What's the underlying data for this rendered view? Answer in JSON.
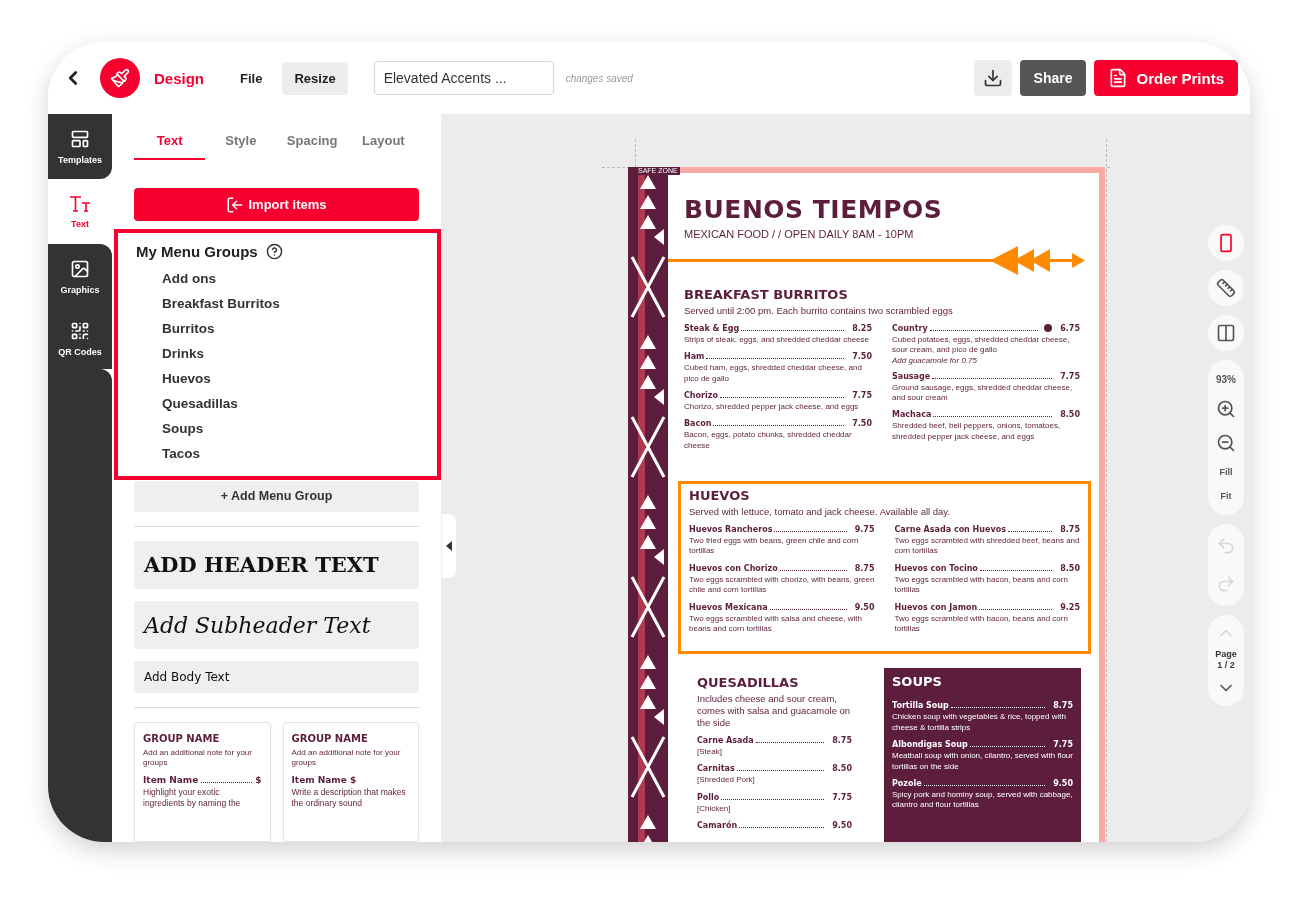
{
  "top_bar": {
    "app_name": "Design",
    "menu": [
      "File",
      "Resize"
    ],
    "document_title": "Elevated Accents ...",
    "save_status": "changes saved",
    "share": "Share",
    "order": "Order Prints"
  },
  "rail": [
    {
      "label": "Templates",
      "selected": false
    },
    {
      "label": "Text",
      "selected": true
    },
    {
      "label": "Graphics",
      "selected": false
    },
    {
      "label": "QR Codes",
      "selected": false
    }
  ],
  "panel": {
    "tabs": [
      {
        "label": "Text",
        "selected": true
      },
      {
        "label": "Style",
        "selected": false
      },
      {
        "label": "Spacing",
        "selected": false
      },
      {
        "label": "Layout",
        "selected": false
      }
    ],
    "import_button": "Import items",
    "menu_groups": {
      "title": "My Menu Groups",
      "highlighted": true,
      "items": [
        "Add ons",
        "Breakfast Burritos",
        "Burritos",
        "Drinks",
        "Huevos",
        "Quesadillas",
        "Soups",
        "Tacos"
      ]
    },
    "add_group": "+ Add Menu Group",
    "text_samples": [
      {
        "kind": "header",
        "text": "ADD HEADER TEXT"
      },
      {
        "kind": "subheader",
        "text": "Add Subheader Text"
      },
      {
        "kind": "body",
        "text": "Add Body Text"
      }
    ],
    "group_cards": [
      {
        "title": "GROUP NAME",
        "note": "Add an additional note for your groups",
        "item_name": "Item Name",
        "price": "$",
        "description": "Highlight your exotic ingredients by naming the"
      },
      {
        "title": "GROUP NAME",
        "note": "Add an additional note for your groups",
        "item_name": "Item Name $",
        "description": "Write a description that makes the ordinary sound"
      }
    ]
  },
  "canvas": {
    "zoom": "93%",
    "fill": "Fill",
    "fit": "Fit",
    "page_label": "Page",
    "page_number": "1 / 2",
    "menu": {
      "safe_zone_label": "SAFE ZONE",
      "title": "BUENOS TIEMPOS",
      "subtitle": "MEXICAN FOOD / / OPEN DAILY 8AM - 10PM",
      "sections": [
        {
          "selected": false,
          "title": "BREAKFAST BURRITOS",
          "note": "Served until 2:00 pm. Each burrito contains two scrambled eggs",
          "columns": [
            [
              {
                "name": "Steak & Egg",
                "price": "8.25",
                "description": "Strips of steak, eggs, and shredded cheddar cheese",
                "veg": false
              },
              {
                "name": "Ham",
                "price": "7.50",
                "description": "Cubed ham, eggs, shredded cheddar cheese, and pico de gallo",
                "veg": false
              },
              {
                "name": "Chorizo",
                "price": "7.75",
                "description": "Chorizo, shredded pepper jack cheese, and eggs",
                "veg": false
              },
              {
                "name": "Bacon",
                "price": "7.50",
                "description": "Bacon, eggs, potato chunks, shredded cheddar cheese",
                "veg": false
              }
            ],
            [
              {
                "name": "Country",
                "price": "6.75",
                "description": "Cubed potatoes, eggs, shredded cheddar cheese, sour cream, and pico de gallo",
                "extra": "Add guacamole for 0.75",
                "veg": true
              },
              {
                "name": "Sausage",
                "price": "7.75",
                "description": "Ground sausage, eggs, shredded cheddar cheese, and sour cream",
                "veg": false
              },
              {
                "name": "Machaca",
                "price": "8.50",
                "description": "Shredded beef, bell peppers, onions, tomatoes, shredded pepper jack cheese, and eggs",
                "veg": false
              }
            ]
          ]
        },
        {
          "selected": true,
          "title": "HUEVOS",
          "note": "Served with lettuce, tomato and jack cheese. Available all day.",
          "columns": [
            [
              {
                "name": "Huevos Rancheros",
                "price": "9.75",
                "description": "Two fried eggs with beans, green chile and corn tortillas",
                "veg": false
              },
              {
                "name": "Huevos con Chorizo",
                "price": "8.75",
                "description": "Two eggs scrambled with chorizo, with beans, green chile and corn tortillas",
                "veg": false
              },
              {
                "name": "Huevos Mexicana",
                "price": "9.50",
                "description": "Two eggs scrambled with salsa and cheese, with beans and corn tortillas",
                "veg": false
              }
            ],
            [
              {
                "name": "Carne Asada con Huevos",
                "price": "8.75",
                "description": "Two eggs scrambled with shredded beef, beans and corn tortillas",
                "veg": false
              },
              {
                "name": "Huevos con Tocino",
                "price": "8.50",
                "description": "Two eggs scrambled with bacon, beans and corn tortillas",
                "veg": false
              },
              {
                "name": "Huevos con Jamon",
                "price": "9.25",
                "description": "Two eggs scrambled with bacon, beans and corn tortillas",
                "veg": false
              }
            ]
          ]
        }
      ],
      "bottom_row": [
        {
          "kind": "light",
          "selected": false,
          "title": "QUESADILLAS",
          "note": "Includes cheese and sour cream, comes with salsa and guacamole on the side",
          "items": [
            {
              "name": "Carne Asada",
              "price": "8.75",
              "description": "[Steak]"
            },
            {
              "name": "Carnitas",
              "price": "8.50",
              "description": "[Shredded Pork]"
            },
            {
              "name": "Pollo",
              "price": "7.75",
              "description": "[Chicken]"
            },
            {
              "name": "Camarón",
              "price": "9.50"
            }
          ]
        },
        {
          "kind": "dark",
          "selected": false,
          "title": "SOUPS",
          "items": [
            {
              "name": "Tortilla Soup",
              "price": "8.75",
              "description": "Chicken soup with vegetables & rice, topped with cheese & tortilla strips"
            },
            {
              "name": "Albondigas Soup",
              "price": "7.75",
              "description": "Meatball soup with onion, cilantro, served with flour tortillas on the side"
            },
            {
              "name": "Pozole",
              "price": "9.50",
              "description": "Spicy pork and hominy soup, served with cabbage, cilantro and flour tortillas"
            }
          ]
        }
      ]
    }
  }
}
